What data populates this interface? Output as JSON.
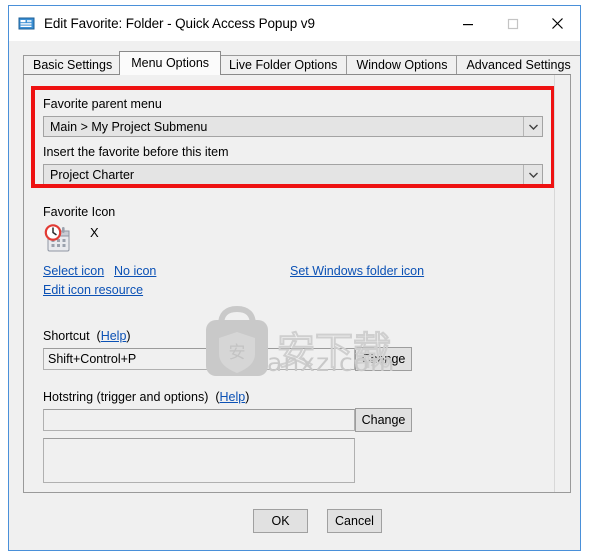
{
  "window": {
    "title": "Edit Favorite: Folder - Quick Access Popup v9",
    "icon": "app-window-icon",
    "minimize_label": "Minimize",
    "maximize_label": "Maximize",
    "close_label": "Close"
  },
  "tabs": [
    {
      "label": "Basic Settings",
      "active": false
    },
    {
      "label": "Menu Options",
      "active": true
    },
    {
      "label": "Live Folder Options",
      "active": false
    },
    {
      "label": "Window Options",
      "active": false
    },
    {
      "label": "Advanced Settings",
      "active": false
    }
  ],
  "menu_options": {
    "parent_menu": {
      "label": "Favorite parent menu",
      "value": "Main > My Project Submenu"
    },
    "insert_before": {
      "label": "Insert the favorite before this item",
      "value": "Project Charter"
    },
    "favorite_icon": {
      "label": "Favorite Icon",
      "icon_name": "calendar-clock-icon",
      "remove_label": "X",
      "select_icon_link": "Select icon",
      "no_icon_link": "No icon",
      "edit_icon_resource_link": "Edit icon resource",
      "set_windows_folder_icon_link": "Set Windows folder icon"
    },
    "shortcut": {
      "label": "Shortcut",
      "help_label": "Help",
      "value": "Shift+Control+P",
      "change_label": "Change"
    },
    "hotstring": {
      "label": "Hotstring (trigger and options)",
      "help_label": "Help",
      "value": "",
      "placeholder": "",
      "options_value": "",
      "change_label": "Change"
    }
  },
  "footer": {
    "ok_label": "OK",
    "cancel_label": "Cancel"
  },
  "watermark": {
    "text": "anxz.com",
    "glyph": "安"
  },
  "colors": {
    "highlight_red": "#ee1111",
    "link_blue": "#0b51b5",
    "window_border": "#4a90d9",
    "panel_bg": "#f0f0f0"
  }
}
